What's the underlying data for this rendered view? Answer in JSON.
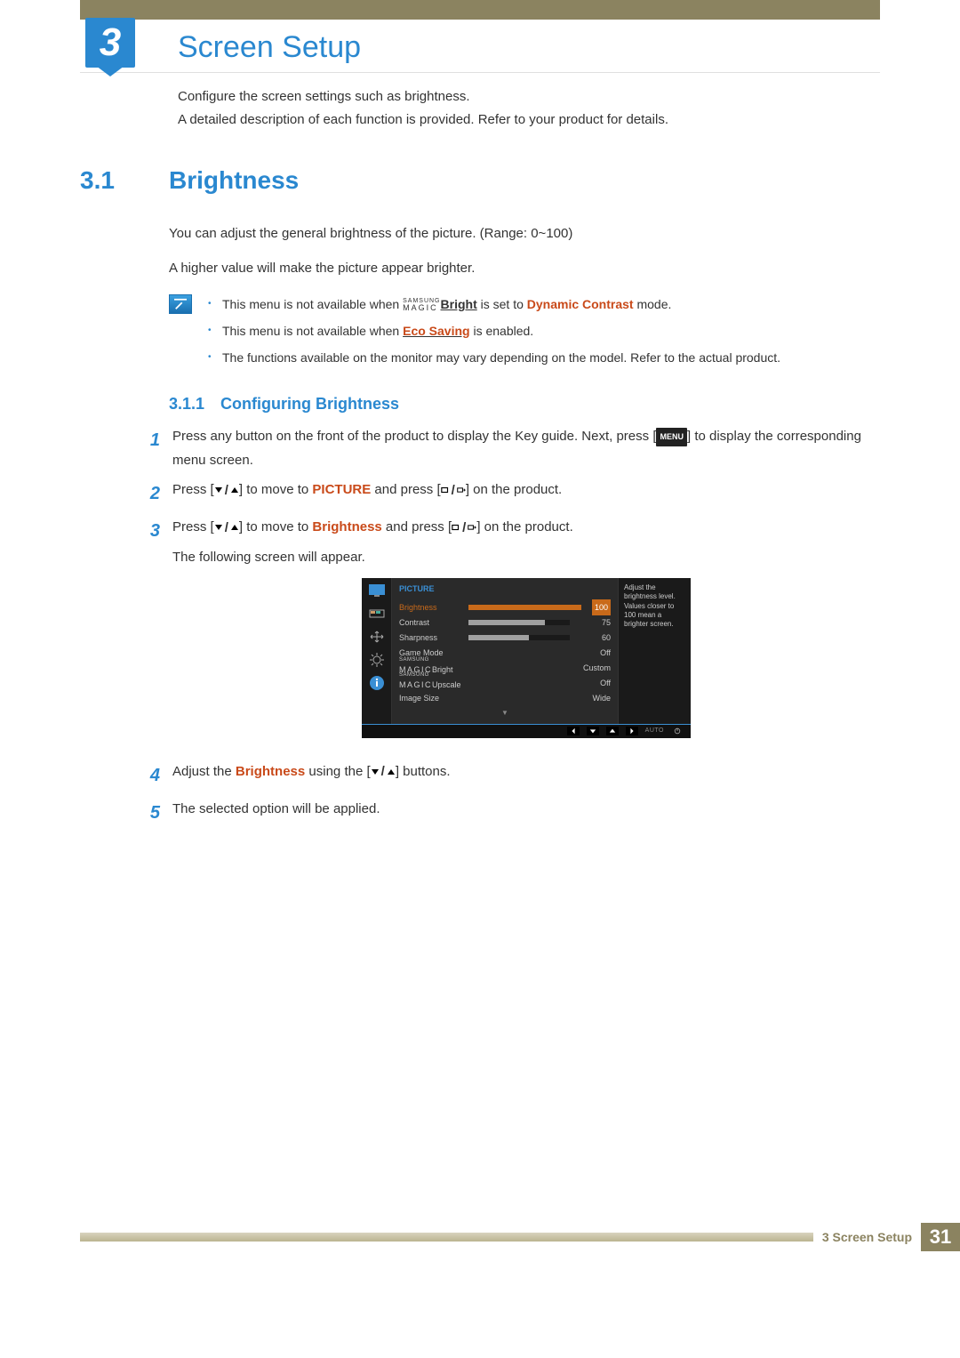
{
  "chapter": {
    "number": "3",
    "title": "Screen Setup"
  },
  "intro": {
    "p1": "Configure the screen settings such as brightness.",
    "p2": "A detailed description of each function is provided. Refer to your product for details."
  },
  "section": {
    "number": "3.1",
    "title": "Brightness"
  },
  "section_body": {
    "p1": "You can adjust the general brightness of the picture. (Range: 0~100)",
    "p2": "A higher value will make the picture appear brighter."
  },
  "notes": {
    "n1a": "This menu is not available when ",
    "n1_magic_top": "SAMSUNG",
    "n1_magic_bot": "MAGIC",
    "n1_bright": "Bright",
    "n1b": " is set to ",
    "n1_mode": "Dynamic Contrast",
    "n1c": " mode.",
    "n2a": "This menu is not available when ",
    "n2_eco": "Eco Saving",
    "n2b": " is enabled.",
    "n3": "The functions available on the monitor may vary depending on the model. Refer to the actual product."
  },
  "subsection": {
    "number": "3.1.1",
    "title": "Configuring Brightness"
  },
  "steps": {
    "s1a": "Press any button on the front of the product to display the Key guide. Next, press [",
    "s1_menu": "MENU",
    "s1b": "] to display the corresponding menu screen.",
    "s2a": "Press [",
    "s2b": "] to move to ",
    "s2_pic": "PICTURE",
    "s2c": " and press [",
    "s2d": "] on the product.",
    "s3a": "Press [",
    "s3b": "] to move to ",
    "s3_bright": "Brightness",
    "s3c": " and press [",
    "s3d": "] on the product.",
    "s3_follow": "The following screen will appear.",
    "s4a": "Adjust the ",
    "s4_bright": "Brightness",
    "s4b": " using the [",
    "s4c": "] buttons.",
    "s5": "The selected option will be applied."
  },
  "osd": {
    "tab": "PICTURE",
    "help": "Adjust the brightness level. Values closer to 100 mean a brighter screen.",
    "rows": [
      {
        "label": "Brightness",
        "value": "100",
        "pct": 100,
        "active": true
      },
      {
        "label": "Contrast",
        "value": "75",
        "pct": 75
      },
      {
        "label": "Sharpness",
        "value": "60",
        "pct": 60
      },
      {
        "label": "Game Mode",
        "value": "Off"
      },
      {
        "label_pre": "SAMSUNG",
        "label_main": "MAGIC",
        "label_suf": "Bright",
        "value": "Custom"
      },
      {
        "label_pre": "SAMSUNG",
        "label_main": "MAGIC",
        "label_suf": "Upscale",
        "value": "Off"
      },
      {
        "label": "Image Size",
        "value": "Wide"
      }
    ],
    "footer_auto": "AUTO"
  },
  "footer": {
    "label": "3 Screen Setup",
    "page": "31"
  }
}
